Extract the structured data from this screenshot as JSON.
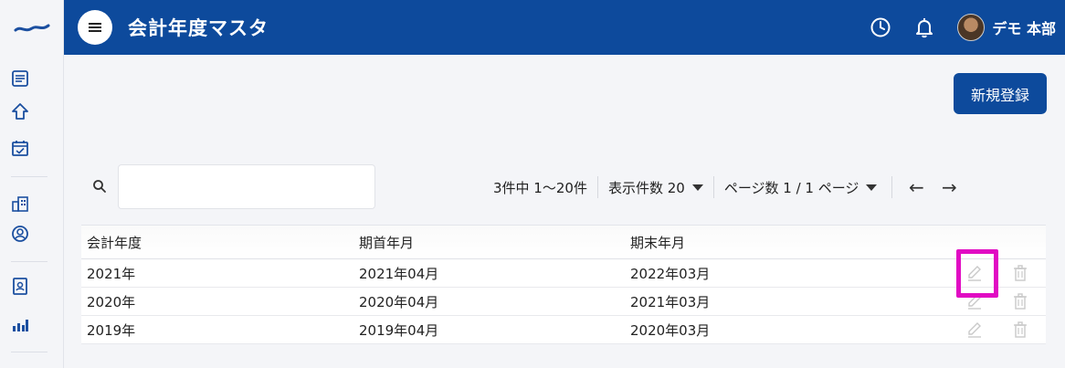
{
  "header": {
    "title": "会計年度マスタ",
    "user_name": "デモ 本部",
    "brand_color": "#0d4a9c"
  },
  "sidebar": {
    "items": [
      {
        "icon": "list-icon"
      },
      {
        "icon": "home-icon"
      },
      {
        "icon": "calendar-check-icon"
      },
      {
        "icon": "building-icon"
      },
      {
        "icon": "user-circle-icon"
      },
      {
        "icon": "id-badge-icon"
      },
      {
        "icon": "bar-chart-icon"
      }
    ]
  },
  "toolbar": {
    "new_button": "新規登録"
  },
  "search": {
    "placeholder": "",
    "value": ""
  },
  "pager": {
    "count_text": "3件中 1〜20件",
    "per_page_text": "表示件数 20",
    "page_text": "ページ数 1 / 1 ページ",
    "prev": "←",
    "next": "→"
  },
  "table": {
    "columns": [
      "会計年度",
      "期首年月",
      "期末年月"
    ],
    "rows": [
      [
        "2021年",
        "2021年04月",
        "2022年03月"
      ],
      [
        "2020年",
        "2020年04月",
        "2021年03月"
      ],
      [
        "2019年",
        "2019年04月",
        "2020年03月"
      ]
    ]
  },
  "highlight_color": "#e10bc3"
}
